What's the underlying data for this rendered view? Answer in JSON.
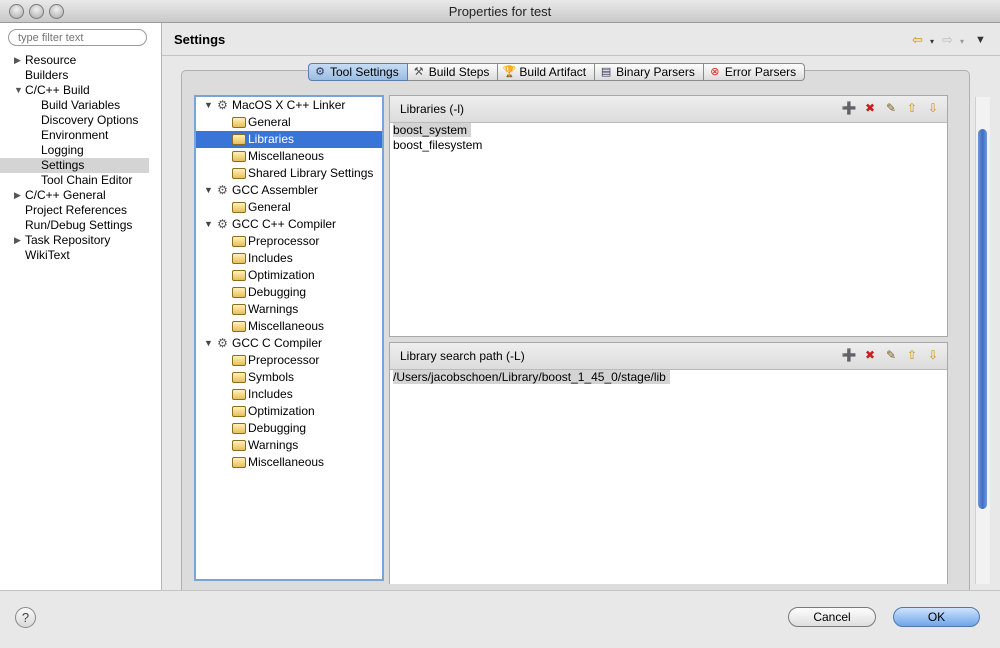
{
  "window": {
    "title": "Properties for test"
  },
  "filter": {
    "placeholder": "type filter text"
  },
  "nav": [
    {
      "label": "Resource",
      "level": 0,
      "twisty": "closed"
    },
    {
      "label": "Builders",
      "level": 0,
      "twisty": "none"
    },
    {
      "label": "C/C++ Build",
      "level": 0,
      "twisty": "open"
    },
    {
      "label": "Build Variables",
      "level": 1,
      "twisty": "none"
    },
    {
      "label": "Discovery Options",
      "level": 1,
      "twisty": "none"
    },
    {
      "label": "Environment",
      "level": 1,
      "twisty": "none"
    },
    {
      "label": "Logging",
      "level": 1,
      "twisty": "none"
    },
    {
      "label": "Settings",
      "level": 1,
      "twisty": "none",
      "selected": true
    },
    {
      "label": "Tool Chain Editor",
      "level": 1,
      "twisty": "none"
    },
    {
      "label": "C/C++ General",
      "level": 0,
      "twisty": "closed"
    },
    {
      "label": "Project References",
      "level": 0,
      "twisty": "none"
    },
    {
      "label": "Run/Debug Settings",
      "level": 0,
      "twisty": "none"
    },
    {
      "label": "Task Repository",
      "level": 0,
      "twisty": "closed"
    },
    {
      "label": "WikiText",
      "level": 0,
      "twisty": "none"
    }
  ],
  "header": {
    "title": "Settings",
    "back_icon": "back-arrow-icon",
    "forward_icon": "forward-arrow-icon",
    "menu_icon": "view-menu-icon"
  },
  "tabs": [
    {
      "label": "Tool Settings",
      "icon": "tool-settings-icon",
      "active": true
    },
    {
      "label": "Build Steps",
      "icon": "build-steps-icon"
    },
    {
      "label": "Build Artifact",
      "icon": "build-artifact-icon"
    },
    {
      "label": "Binary Parsers",
      "icon": "binary-parsers-icon"
    },
    {
      "label": "Error Parsers",
      "icon": "error-parsers-icon"
    }
  ],
  "tool_tree": [
    {
      "label": "MacOS X C++ Linker",
      "level": 0,
      "type": "tool"
    },
    {
      "label": "General",
      "level": 1,
      "type": "option"
    },
    {
      "label": "Libraries",
      "level": 1,
      "type": "option",
      "selected": true
    },
    {
      "label": "Miscellaneous",
      "level": 1,
      "type": "option"
    },
    {
      "label": "Shared Library Settings",
      "level": 1,
      "type": "option"
    },
    {
      "label": "GCC Assembler",
      "level": 0,
      "type": "tool"
    },
    {
      "label": "General",
      "level": 1,
      "type": "option"
    },
    {
      "label": "GCC C++ Compiler",
      "level": 0,
      "type": "tool"
    },
    {
      "label": "Preprocessor",
      "level": 1,
      "type": "option"
    },
    {
      "label": "Includes",
      "level": 1,
      "type": "option"
    },
    {
      "label": "Optimization",
      "level": 1,
      "type": "option"
    },
    {
      "label": "Debugging",
      "level": 1,
      "type": "option"
    },
    {
      "label": "Warnings",
      "level": 1,
      "type": "option"
    },
    {
      "label": "Miscellaneous",
      "level": 1,
      "type": "option"
    },
    {
      "label": "GCC C Compiler",
      "level": 0,
      "type": "tool"
    },
    {
      "label": "Preprocessor",
      "level": 1,
      "type": "option"
    },
    {
      "label": "Symbols",
      "level": 1,
      "type": "option"
    },
    {
      "label": "Includes",
      "level": 1,
      "type": "option"
    },
    {
      "label": "Optimization",
      "level": 1,
      "type": "option"
    },
    {
      "label": "Debugging",
      "level": 1,
      "type": "option"
    },
    {
      "label": "Warnings",
      "level": 1,
      "type": "option"
    },
    {
      "label": "Miscellaneous",
      "level": 1,
      "type": "option"
    }
  ],
  "libraries": {
    "title": "Libraries (-l)",
    "items": [
      "boost_system",
      "boost_filesystem"
    ]
  },
  "search_path": {
    "title": "Library search path (-L)",
    "items": [
      "/Users/jacobschoen/Library/boost_1_45_0/stage/lib"
    ]
  },
  "list_tools": [
    {
      "name": "add-icon",
      "glyph": "➕"
    },
    {
      "name": "delete-icon",
      "glyph": "✖"
    },
    {
      "name": "edit-icon",
      "glyph": "✎"
    },
    {
      "name": "move-up-icon",
      "glyph": "⇧"
    },
    {
      "name": "move-down-icon",
      "glyph": "⇩"
    }
  ],
  "buttons": {
    "help": "?",
    "cancel": "Cancel",
    "ok": "OK"
  }
}
